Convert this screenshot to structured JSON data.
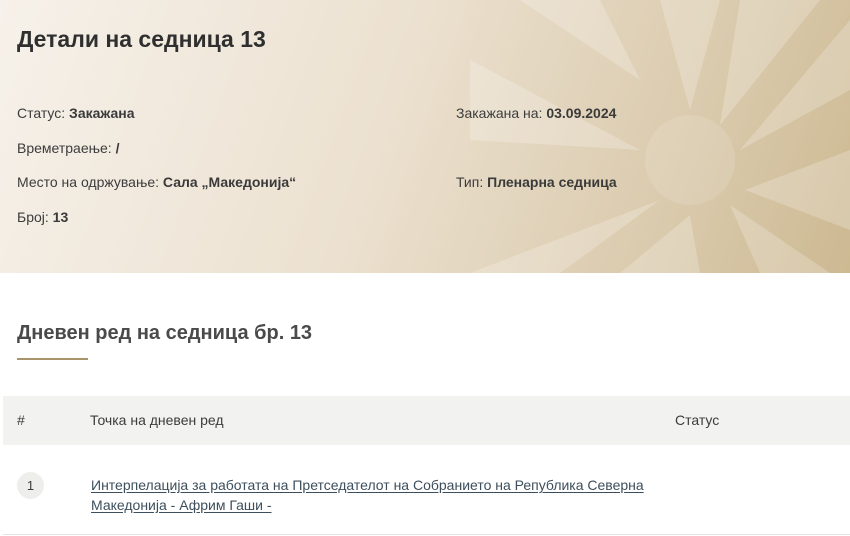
{
  "page": {
    "title": "Детали на седница 13"
  },
  "meta": {
    "status_label": "Статус:",
    "status_value": "Закажана",
    "duration_label": "Времетраење:",
    "duration_value": "/",
    "location_label": "Место на одржување:",
    "location_value": "Сала „Македонија“",
    "number_label": "Број:",
    "number_value": "13",
    "scheduled_label": "Закажана на:",
    "scheduled_value": "03.09.2024",
    "type_label": "Тип:",
    "type_value": "Пленарна седница"
  },
  "agenda": {
    "title": "Дневен ред на седница бр. 13",
    "columns": {
      "number": "#",
      "item": "Точка на дневен ред",
      "status": "Статус"
    },
    "rows": [
      {
        "number": "1",
        "item": "Интерпелација за работата на Претседателот на Собранието на Република Северна Македонија - Африм Гаши -",
        "status": ""
      }
    ]
  },
  "colors": {
    "accent_underline": "#a8956a",
    "link": "#3d4f5c",
    "table_header_bg": "#f2f2f0"
  }
}
